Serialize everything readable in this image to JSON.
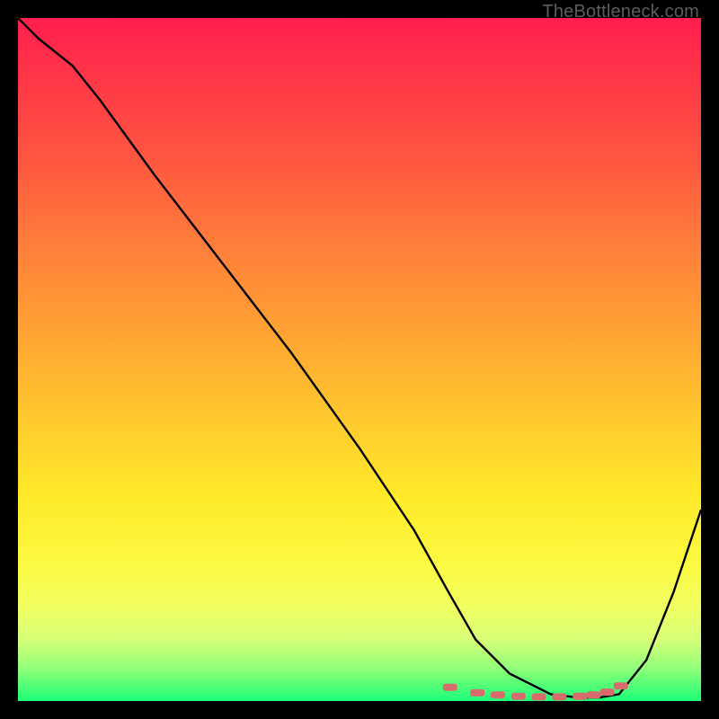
{
  "attribution": "TheBottleneck.com",
  "colors": {
    "frame": "#000000",
    "curve": "#000000",
    "marker": "#d86b6b",
    "attribution_text": "#5c5c5c"
  },
  "chart_data": {
    "type": "line",
    "title": "",
    "xlabel": "",
    "ylabel": "",
    "xlim": [
      0,
      100
    ],
    "ylim": [
      0,
      100
    ],
    "x": [
      0,
      3,
      8,
      12,
      20,
      30,
      40,
      50,
      58,
      63,
      67,
      72,
      78,
      82,
      85,
      88,
      92,
      96,
      100
    ],
    "values": [
      100,
      97,
      93,
      88,
      77,
      64,
      51,
      37,
      25,
      16,
      9,
      4,
      1,
      0.5,
      0.5,
      1,
      6,
      16,
      28
    ],
    "markers_x": [
      63,
      67,
      70,
      73,
      76,
      79,
      82,
      84,
      86,
      88
    ],
    "markers_y": [
      2.0,
      1.2,
      0.9,
      0.7,
      0.6,
      0.6,
      0.7,
      0.9,
      1.3,
      2.2
    ]
  }
}
